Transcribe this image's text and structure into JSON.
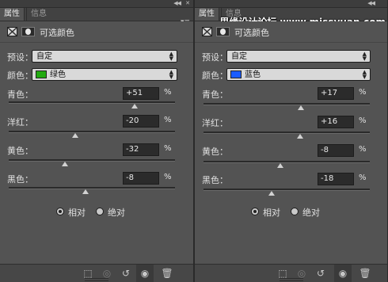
{
  "panels": [
    {
      "tabs": [
        "属性",
        "信息"
      ],
      "adjustment_title": "可选颜色",
      "preset": {
        "label": "预设：",
        "value": "自定"
      },
      "color": {
        "label": "颜色：",
        "value": "绿色",
        "swatch": "#22aa11"
      },
      "sliders": [
        {
          "label": "青色：",
          "value": "+51",
          "unit": "%",
          "percent": 51
        },
        {
          "label": "洋红：",
          "value": "-20",
          "unit": "%",
          "percent": -20
        },
        {
          "label": "黄色：",
          "value": "-32",
          "unit": "%",
          "percent": -32
        },
        {
          "label": "黑色：",
          "value": "-8",
          "unit": "%",
          "percent": -8
        }
      ],
      "method": {
        "relative": "相对",
        "absolute": "绝对",
        "selected": "relative"
      },
      "watermark": ""
    },
    {
      "tabs": [
        "属性",
        "信息"
      ],
      "adjustment_title": "可选颜色",
      "preset": {
        "label": "预设：",
        "value": "自定"
      },
      "color": {
        "label": "颜色：",
        "value": "蓝色",
        "swatch": "#1a5cff"
      },
      "sliders": [
        {
          "label": "青色：",
          "value": "+17",
          "unit": "%",
          "percent": 17
        },
        {
          "label": "洋红：",
          "value": "+16",
          "unit": "%",
          "percent": 16
        },
        {
          "label": "黄色：",
          "value": "-8",
          "unit": "%",
          "percent": -8
        },
        {
          "label": "黑色：",
          "value": "-18",
          "unit": "%",
          "percent": -18
        }
      ],
      "method": {
        "relative": "相对",
        "absolute": "绝对",
        "selected": "relative"
      },
      "watermark": "思缘设计论坛 www.missyuan.com"
    }
  ],
  "icons": {
    "collapse": "double-chevron-icon",
    "close": "close-icon",
    "panel_menu": "panel-menu-icon",
    "clip": "clip-to-layer-icon",
    "view_previous": "view-previous-icon",
    "reset": "reset-icon",
    "visibility": "eye-icon",
    "delete": "trash-icon"
  }
}
